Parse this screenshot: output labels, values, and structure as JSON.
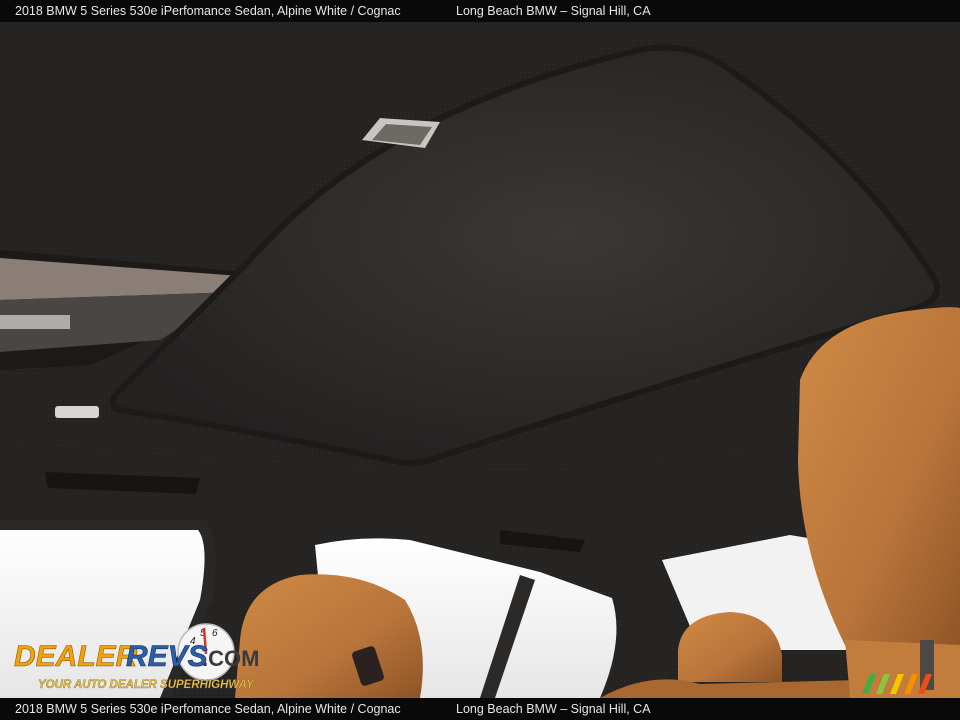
{
  "caption": {
    "title": "2018 BMW 5 Series 530e iPerfomance Sedan,  Alpine White / Cognac",
    "dealer": "Long Beach BMW – Signal Hill, CA"
  },
  "watermark": {
    "brand": "DealerRevs.com",
    "tagline": "Your Auto Dealer SuperHighway",
    "brand_color": "#f2a20c",
    "accent_color": "#2a5ea8"
  },
  "photo": {
    "subject": "sunroof-interior",
    "headliner_color": "#2d2b2a",
    "seat_color": "#b8743a"
  }
}
